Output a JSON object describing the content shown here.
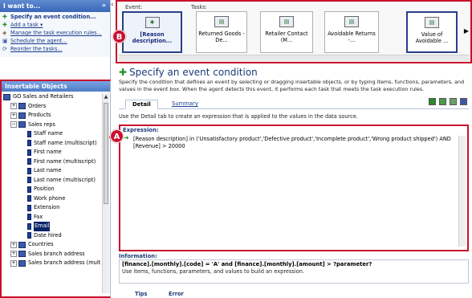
{
  "left_panel": {
    "header": "I want to...",
    "tasks": [
      {
        "icon": "✚",
        "label": "Specify an event condition..."
      },
      {
        "icon": "✚",
        "label": "Add a task ▾"
      },
      {
        "icon": "◈",
        "label": "Manage the task execution rules..."
      },
      {
        "icon": "▣",
        "label": "Schedule the agent..."
      },
      {
        "icon": "⟳",
        "label": "Reorder the tasks..."
      }
    ],
    "insertable_header": "Insertable Objects",
    "tree": [
      {
        "label": "GO Sales and Retailers",
        "level": 0,
        "kind": "package",
        "expander": ""
      },
      {
        "label": "Orders",
        "level": 1,
        "kind": "folder",
        "expander": "+"
      },
      {
        "label": "Products",
        "level": 1,
        "kind": "folder",
        "expander": "+"
      },
      {
        "label": "Sales reps",
        "level": 1,
        "kind": "folder",
        "expander": "−"
      },
      {
        "label": "Staff name",
        "level": 2,
        "kind": "item",
        "expander": ""
      },
      {
        "label": "Staff name (multiscript)",
        "level": 2,
        "kind": "item",
        "expander": ""
      },
      {
        "label": "First name",
        "level": 2,
        "kind": "item",
        "expander": ""
      },
      {
        "label": "First name (multiscript)",
        "level": 2,
        "kind": "item",
        "expander": ""
      },
      {
        "label": "Last name",
        "level": 2,
        "kind": "item",
        "expander": ""
      },
      {
        "label": "Last name (multiscript)",
        "level": 2,
        "kind": "item",
        "expander": ""
      },
      {
        "label": "Position",
        "level": 2,
        "kind": "item",
        "expander": ""
      },
      {
        "label": "Work phone",
        "level": 2,
        "kind": "item",
        "expander": ""
      },
      {
        "label": "Extension",
        "level": 2,
        "kind": "item",
        "expander": ""
      },
      {
        "label": "Fax",
        "level": 2,
        "kind": "item",
        "expander": ""
      },
      {
        "label": "Email",
        "level": 2,
        "kind": "item",
        "expander": "",
        "selected": true
      },
      {
        "label": "Date hired",
        "level": 2,
        "kind": "item",
        "expander": ""
      },
      {
        "label": "Countries",
        "level": 1,
        "kind": "folder",
        "expander": "+"
      },
      {
        "label": "Sales branch address",
        "level": 1,
        "kind": "folder",
        "expander": "+"
      },
      {
        "label": "Sales branch address (mult",
        "level": 1,
        "kind": "folder",
        "expander": "+"
      }
    ]
  },
  "taskbar": {
    "event_label": "Event:",
    "tasks_label": "Tasks:",
    "event_card": {
      "label": "[Reason description...",
      "icon": "event-icon"
    },
    "tasks": [
      {
        "label": "Returned Goods - De...",
        "icon": "task-icon"
      },
      {
        "label": "Retailer Contact (M...",
        "icon": "task-icon"
      },
      {
        "label": "Avoidable Returns -...",
        "icon": "task-icon"
      },
      {
        "label": "Value of Avoidable ...",
        "icon": "task-icon"
      }
    ]
  },
  "badges": {
    "a": "A",
    "b": "B"
  },
  "main": {
    "title": "Specify an event condition",
    "description": "Specify the condition that defines an event by selecting or dragging insertable objects, or by typing items, functions, parameters, and values in the event box. When the agent detects this event, it performs each task that meets the task execution rules.",
    "tabs": {
      "detail": "Detail",
      "summary": "Summary"
    },
    "detail_hint": "Use the Detail tab to create an expression that is applied to the values in the data source.",
    "expression_label": "Expression:",
    "expression_text": "[Reason description] in ('Unsatisfactory product','Defective product','Incomplete product','Wrong product shipped') AND [Revenue] > 20000",
    "information_label": "Information:",
    "info_bold": "[finance].[monthly].[code] = 'A' and [finance].[monthly].[amount] > ?parameter?",
    "info_text": "Use items, functions, parameters, and values to build an expression.",
    "bottom_tabs": {
      "tips": "Tips",
      "errors": "Error"
    }
  },
  "colors": {
    "accent_red": "#c8102e",
    "header_blue": "#3a68b8",
    "title_blue": "#1c3a78",
    "go_green": "#2a8a2a"
  }
}
